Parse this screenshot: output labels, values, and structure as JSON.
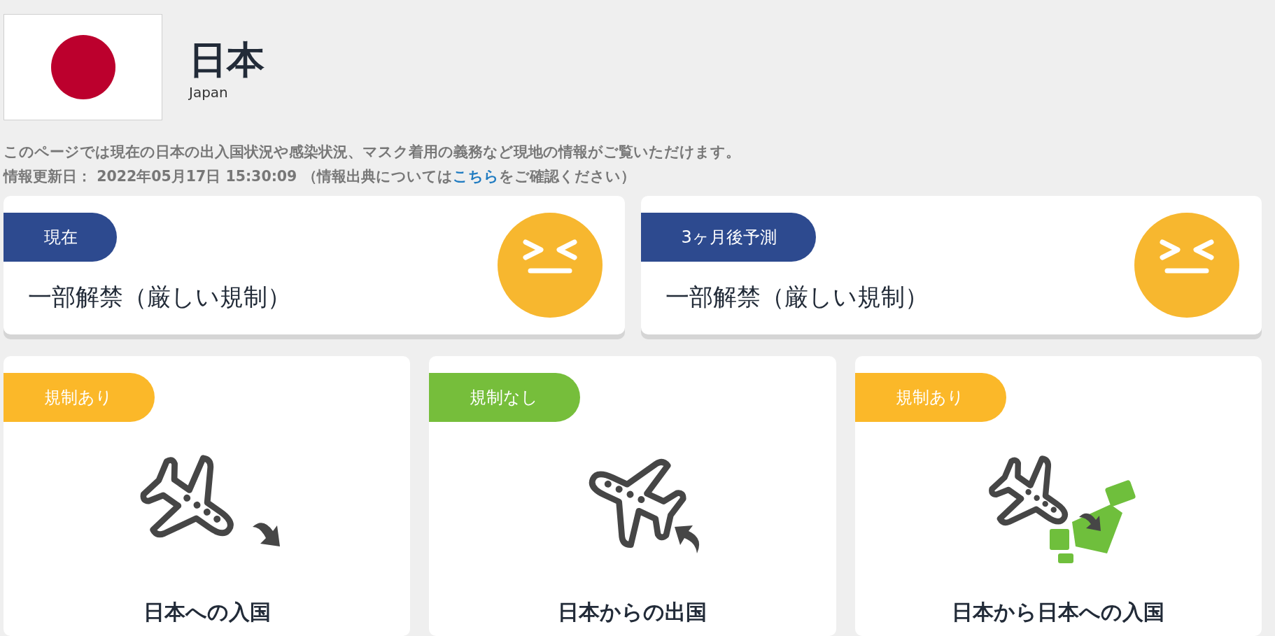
{
  "header": {
    "title": "日本",
    "subtitle": "Japan"
  },
  "description": "このページでは現在の日本の出入国状況や感染状況、マスク着用の義務など現地の情報がご覧いただけます。",
  "update": {
    "before": "情報更新日： 2022年05月17日 15:30:09 （情報出典については",
    "link": "こちら",
    "after": "をご確認ください）"
  },
  "status_cards": [
    {
      "label": "現在",
      "text": "一部解禁（厳しい規制）",
      "kind": "strict"
    },
    {
      "label": "3ヶ月後予測",
      "text": "一部解禁（厳しい規制）",
      "kind": "strict"
    }
  ],
  "travel_cards": [
    {
      "tag": "規制あり",
      "color": "#fbb829",
      "kind": "arrival",
      "title": "日本への入国"
    },
    {
      "tag": "規制なし",
      "color": "#76be3b",
      "kind": "departure",
      "title": "日本からの出国"
    },
    {
      "tag": "規制あり",
      "color": "#fbb829",
      "kind": "domestic",
      "title": "日本から日本への入国"
    }
  ]
}
